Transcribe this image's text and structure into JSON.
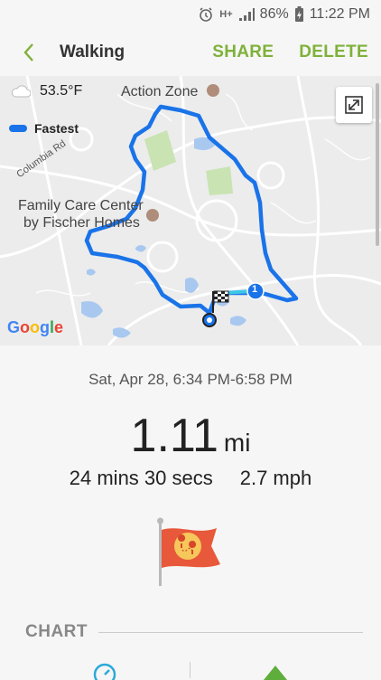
{
  "status": {
    "battery": "86%",
    "time": "11:22 PM"
  },
  "header": {
    "title": "Walking",
    "share": "SHARE",
    "delete": "DELETE"
  },
  "map": {
    "temperature": "53.5°F",
    "legend": "Fastest",
    "places": {
      "action_zone": "Action Zone",
      "family_care_1": "Family Care Center",
      "family_care_2": "by Fischer Homes"
    },
    "road": "Columbia Rd",
    "route_color": "#1a73e8",
    "marker_label": "1"
  },
  "workout": {
    "date": "Sat, Apr 28, 6:34 PM-6:58 PM",
    "distance": "1.11",
    "distance_unit": "mi",
    "duration": "24 mins 30 secs",
    "speed": "2.7 mph"
  },
  "chart_section": {
    "title": "CHART"
  },
  "colors": {
    "accent": "#7fb13a",
    "route": "#1a73e8"
  }
}
